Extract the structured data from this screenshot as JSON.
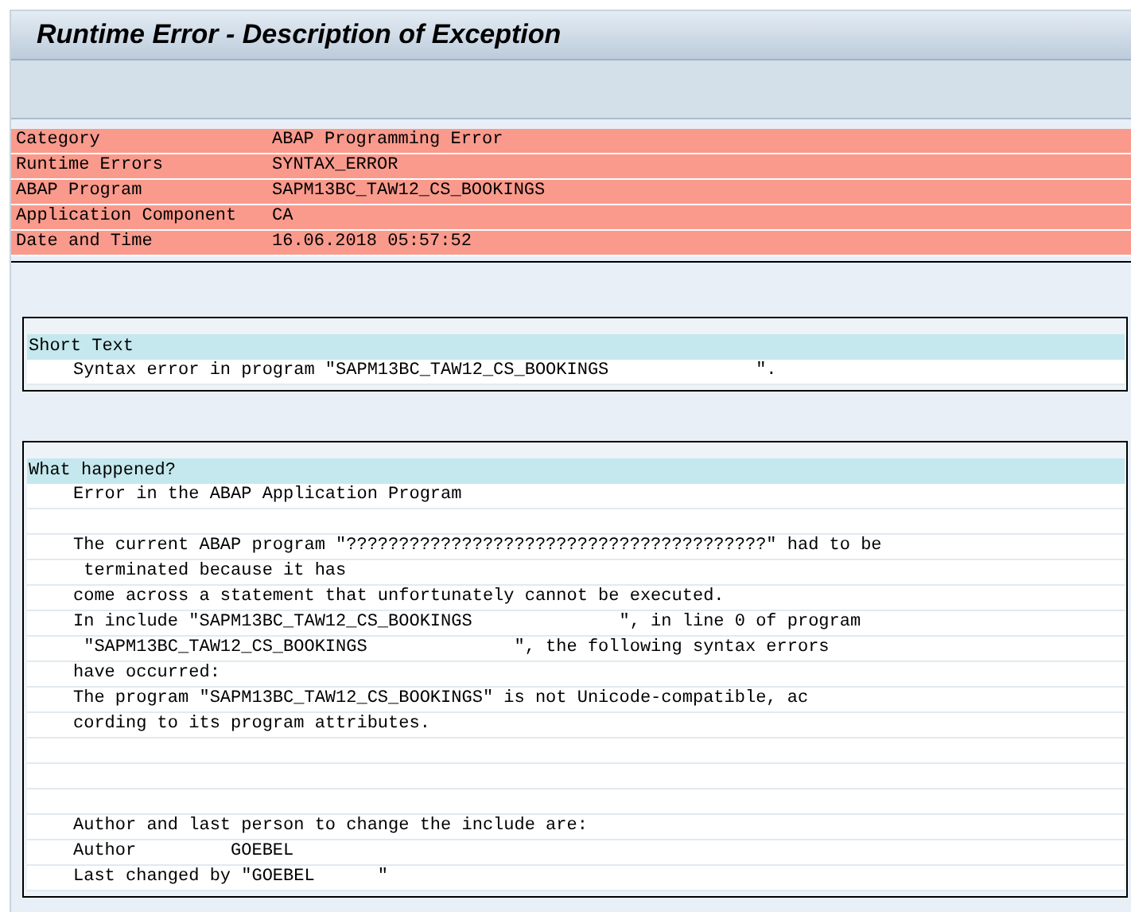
{
  "window": {
    "title": "Runtime Error - Description of Exception"
  },
  "header": [
    {
      "label": "Category",
      "value": "ABAP Programming Error"
    },
    {
      "label": "Runtime Errors",
      "value": "SYNTAX_ERROR"
    },
    {
      "label": "ABAP Program",
      "value": "SAPM13BC_TAW12_CS_BOOKINGS"
    },
    {
      "label": "Application Component",
      "value": "CA"
    },
    {
      "label": "Date and Time",
      "value": "16.06.2018 05:57:52"
    }
  ],
  "sections": [
    {
      "title": "Short Text",
      "lines": [
        {
          "kind": "text",
          "text": "Syntax error in program \"SAPM13BC_TAW12_CS_BOOKINGS              \"."
        }
      ]
    },
    {
      "title": "What happened?",
      "lines": [
        {
          "kind": "text",
          "text": "Error in the ABAP Application Program"
        },
        {
          "kind": "blank"
        },
        {
          "kind": "text",
          "text": "The current ABAP program \"????????????????????????????????????????\" had to be"
        },
        {
          "kind": "text",
          "text": " terminated because it has"
        },
        {
          "kind": "text",
          "text": "come across a statement that unfortunately cannot be executed."
        },
        {
          "kind": "text",
          "text": "In include \"SAPM13BC_TAW12_CS_BOOKINGS              \", in line 0 of program"
        },
        {
          "kind": "text",
          "text": " \"SAPM13BC_TAW12_CS_BOOKINGS              \", the following syntax errors"
        },
        {
          "kind": "text",
          "text": "have occurred:"
        },
        {
          "kind": "text",
          "text": "The program \"SAPM13BC_TAW12_CS_BOOKINGS\" is not Unicode-compatible, ac"
        },
        {
          "kind": "text",
          "text": "cording to its program attributes."
        },
        {
          "kind": "blank"
        },
        {
          "kind": "blank"
        },
        {
          "kind": "blank"
        },
        {
          "kind": "text",
          "text": "Author and last person to change the include are:"
        },
        {
          "kind": "text",
          "text": "Author         GOEBEL"
        },
        {
          "kind": "text",
          "text": "Last changed by \"GOEBEL      \""
        }
      ]
    }
  ]
}
